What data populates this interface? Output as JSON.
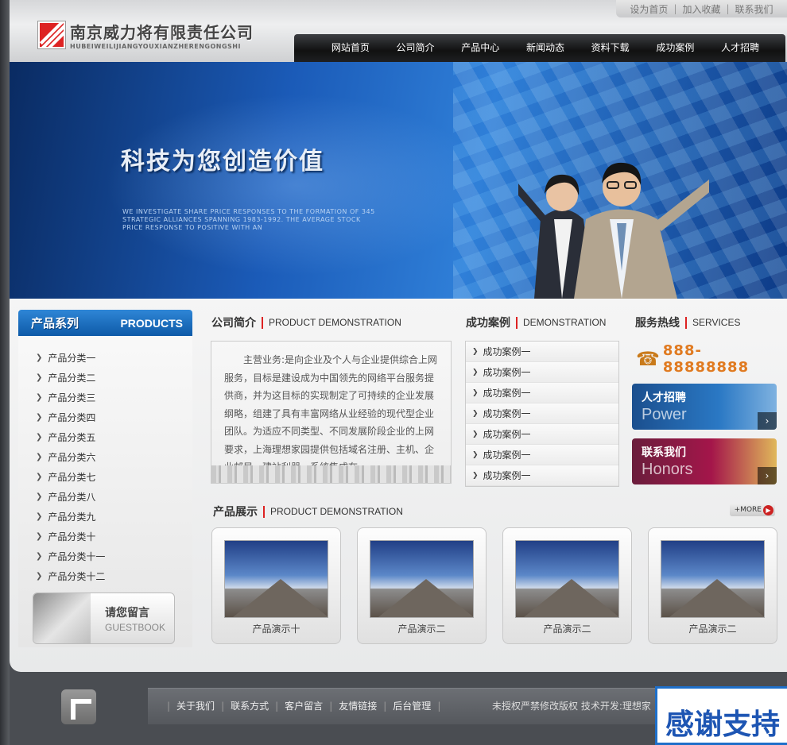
{
  "company": {
    "name_cn": "南京威力将有限责任公司",
    "name_en": "HUBEIWEILIJIANGYOUXIANZHERENGONGSHI"
  },
  "top_links": [
    "设为首页",
    "加入收藏",
    "联系我们"
  ],
  "nav": [
    "网站首页",
    "公司简介",
    "产品中心",
    "新闻动态",
    "资料下载",
    "成功案例",
    "人才招聘"
  ],
  "banner": {
    "title": "科技为您创造价值",
    "subtitle": "WE INVESTIGATE SHARE PRICE RESPONSES TO THE FORMATION OF 345 STRATEGIC ALLIANCES SPANNING 1983-1992. THE AVERAGE STOCK PRICE RESPONSE TO POSITIVE WITH AN"
  },
  "sidebar": {
    "title_cn": "产品系列",
    "title_en": "PRODUCTS",
    "categories": [
      "产品分类一",
      "产品分类二",
      "产品分类三",
      "产品分类四",
      "产品分类五",
      "产品分类六",
      "产品分类七",
      "产品分类八",
      "产品分类九",
      "产品分类十",
      "产品分类十一",
      "产品分类十二"
    ],
    "guestbook_cn": "请您留言",
    "guestbook_en": "GUESTBOOK"
  },
  "about": {
    "title_cn": "公司简介",
    "title_en": "PRODUCT DEMONSTRATION",
    "text": "主营业务:是向企业及个人与企业提供综合上网服务，目标是建设成为中国领先的网络平台服务提供商，并为这目标的实现制定了可持续的企业发展纲略，组建了具有丰富网络从业经验的现代型企业团队。为适应不同类型、不同发展阶段企业的上网要求，上海理想家园提供包括域名注册、主机、企业邮局、建站利器、系统集成在..."
  },
  "cases": {
    "title_cn": "成功案例",
    "title_en": "DEMONSTRATION",
    "items": [
      "成功案例一",
      "成功案例一",
      "成功案例一",
      "成功案例一",
      "成功案例一",
      "成功案例一",
      "成功案例一"
    ]
  },
  "services": {
    "title_cn": "服务热线",
    "title_en": "SERVICES",
    "phone": "888-88888888",
    "jobs_cn": "人才招聘",
    "jobs_en": "Power",
    "contact_cn": "联系我们",
    "contact_en": "Honors"
  },
  "products": {
    "title_cn": "产品展示",
    "title_en": "PRODUCT DEMONSTRATION",
    "more": "+MORE",
    "items": [
      "产品演示十",
      "产品演示二",
      "产品演示二",
      "产品演示二"
    ]
  },
  "footer": {
    "links": [
      "关于我们",
      "联系方式",
      "客户留言",
      "友情链接",
      "后台管理"
    ],
    "copyright": "未授权严禁修改版权 技术开发:理想家",
    "thanks": "感谢支持"
  },
  "colors": {
    "accent_red": "#d22222",
    "nav_bg": "#1a1b1e",
    "sidebar_blue": "#1f6fc4"
  }
}
